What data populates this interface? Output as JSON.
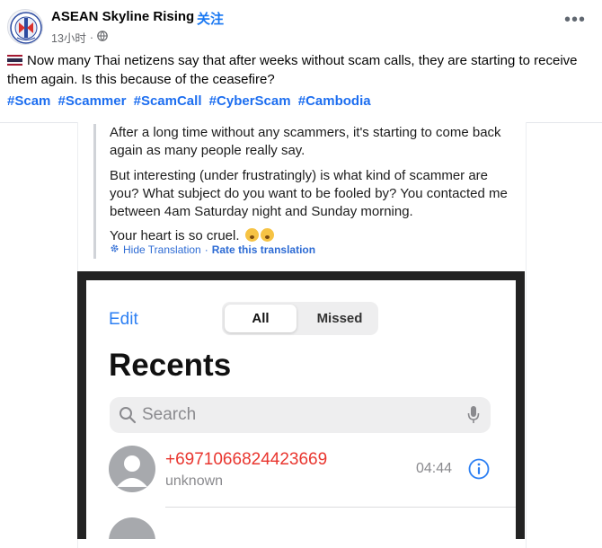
{
  "post": {
    "page_name": "ASEAN Skyline Rising",
    "separator": "·",
    "follow_label": "关注",
    "timestamp": "13小时",
    "meta_dot": "·",
    "privacy_icon": "globe-icon",
    "caption": "Now many Thai netizens say that after weeks without scam calls, they are starting to receive them again. Is this because of the ceasefire?",
    "hashtags": [
      "#Scam",
      "#Scammer",
      "#ScamCall",
      "#CyberScam",
      "#Cambodia"
    ]
  },
  "translated_comment": {
    "p1": "After a long time without any scammers, it's starting to come back again as many people really say.",
    "p2": "But interesting (under frustratingly) is what kind of scammer are you? What subject do you want to be fooled by? You contacted me between 4am Saturday night and Sunday morning.",
    "p3": "Your heart is so cruel.",
    "hide_translation": "Hide Translation",
    "dot": "·",
    "rate_translation": "Rate this translation"
  },
  "phone": {
    "edit_label": "Edit",
    "tabs": [
      "All",
      "Missed"
    ],
    "selected_tab": "All",
    "title": "Recents",
    "search_placeholder": "Search",
    "calls": [
      {
        "number": "+6971066824423669",
        "type": "unknown",
        "time": "04:44"
      }
    ]
  },
  "colors": {
    "link_blue": "#1877f2",
    "missed_red": "#e9362f",
    "ios_blue": "#2c7ff3"
  }
}
